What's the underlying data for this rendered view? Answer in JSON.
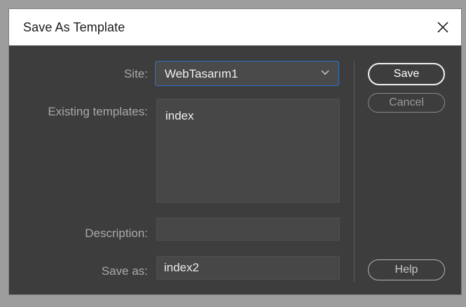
{
  "dialog": {
    "title": "Save As Template",
    "close_icon": "close-icon"
  },
  "form": {
    "site_label": "Site:",
    "site_value": "WebTasarım1",
    "existing_templates_label": "Existing templates:",
    "existing_templates": [
      "index"
    ],
    "description_label": "Description:",
    "description_value": "",
    "save_as_label": "Save as:",
    "save_as_value": "index2"
  },
  "buttons": {
    "save": "Save",
    "cancel": "Cancel",
    "help": "Help"
  },
  "colors": {
    "dialog_bg": "#3d3d3d",
    "accent_border": "#2c72c4"
  }
}
